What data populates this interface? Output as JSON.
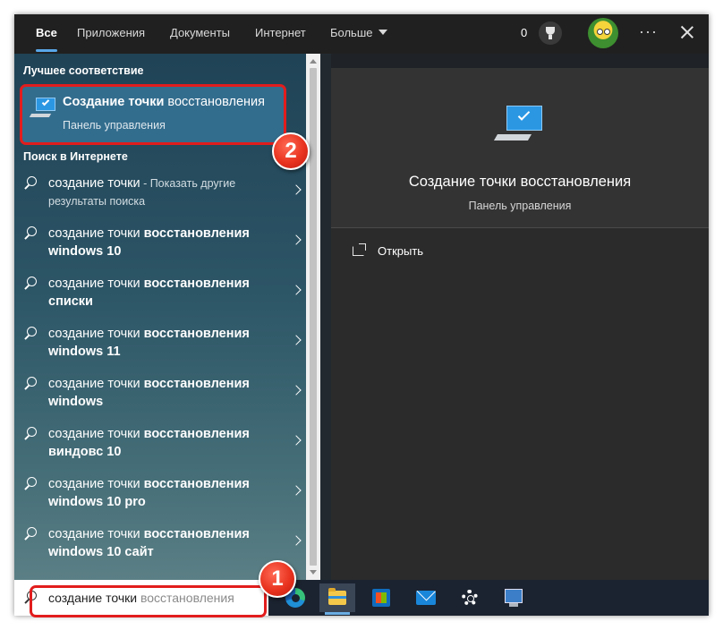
{
  "tabs": [
    {
      "label": "Все",
      "active": true
    },
    {
      "label": "Приложения"
    },
    {
      "label": "Документы"
    },
    {
      "label": "Интернет"
    },
    {
      "label": "Больше"
    }
  ],
  "header": {
    "points": "0",
    "more": "···"
  },
  "best_match": {
    "section_title": "Лучшее соответствие",
    "name_bold": "Создание точки",
    "name_rest": " восстановления",
    "subtitle": "Панель управления"
  },
  "web": {
    "section_title": "Поиск в Интернете",
    "results": [
      {
        "lead": "создание точки",
        "suffix": " - Показать другие результаты поиска"
      },
      {
        "lead": "создание точки ",
        "bold": "восстановления windows 10"
      },
      {
        "lead": "создание точки ",
        "bold": "восстановления списки"
      },
      {
        "lead": "создание точки ",
        "bold": "восстановления windows 11"
      },
      {
        "lead": "создание точки ",
        "bold": "восстановления windows"
      },
      {
        "lead": "создание точки ",
        "bold": "восстановления виндовс 10"
      },
      {
        "lead": "создание точки ",
        "bold": "восстановления windows 10 pro"
      },
      {
        "lead": "создание точки ",
        "bold": "восстановления windows 10 сайт"
      }
    ]
  },
  "preview": {
    "title": "Создание точки восстановления",
    "subtitle": "Панель управления",
    "action_open": "Открыть"
  },
  "search": {
    "typed": "создание точки",
    "completion": " восстановления"
  },
  "annotations": {
    "badge1": "1",
    "badge2": "2"
  },
  "colors": {
    "accent": "#58a7e8",
    "highlight": "#e21d1d",
    "best_bg": "#336d8e"
  }
}
